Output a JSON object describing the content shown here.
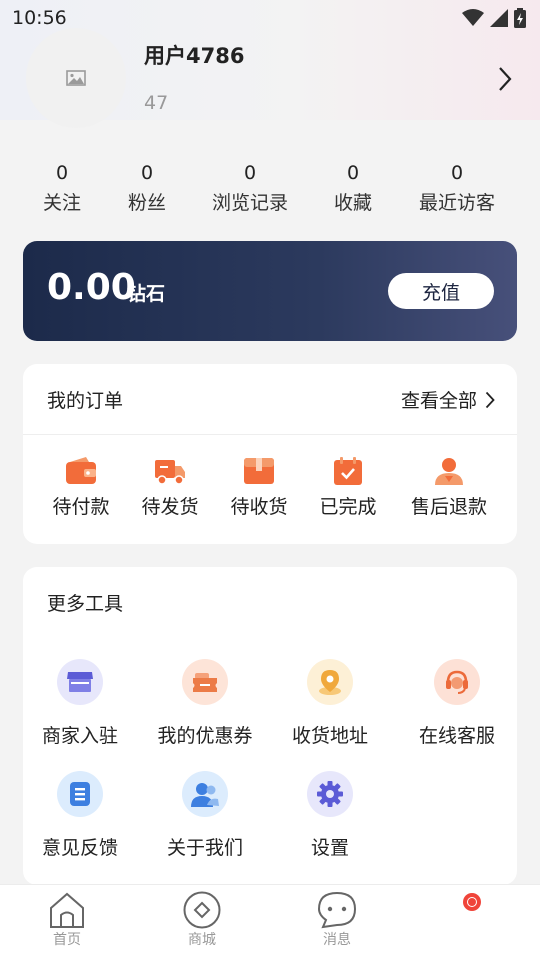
{
  "status_bar": {
    "time": "10:56"
  },
  "profile": {
    "username": "用户4786",
    "sub_value": "47"
  },
  "stats": [
    {
      "value": "0",
      "label": "关注"
    },
    {
      "value": "0",
      "label": "粉丝"
    },
    {
      "value": "0",
      "label": "浏览记录"
    },
    {
      "value": "0",
      "label": "收藏"
    },
    {
      "value": "0",
      "label": "最近访客"
    }
  ],
  "balance": {
    "value": "0.00",
    "unit": "钻石",
    "recharge_label": "充值"
  },
  "orders": {
    "title": "我的订单",
    "view_all": "查看全部",
    "items": [
      {
        "label": "待付款",
        "icon": "wallet-icon"
      },
      {
        "label": "待发货",
        "icon": "truck-icon"
      },
      {
        "label": "待收货",
        "icon": "package-icon"
      },
      {
        "label": "已完成",
        "icon": "completed-icon"
      },
      {
        "label": "售后退款",
        "icon": "service-icon"
      }
    ]
  },
  "tools": {
    "title": "更多工具",
    "items": [
      {
        "label": "商家入驻",
        "icon": "store-icon"
      },
      {
        "label": "我的优惠券",
        "icon": "coupon-icon"
      },
      {
        "label": "收货地址",
        "icon": "location-icon"
      },
      {
        "label": "在线客服",
        "icon": "headset-icon"
      },
      {
        "label": "意见反馈",
        "icon": "feedback-icon"
      },
      {
        "label": "关于我们",
        "icon": "users-icon"
      },
      {
        "label": "设置",
        "icon": "gear-icon"
      }
    ]
  },
  "tabbar": {
    "items": [
      {
        "label": "首页",
        "icon": "home-icon"
      },
      {
        "label": "商城",
        "icon": "shop-icon"
      },
      {
        "label": "消息",
        "icon": "message-icon"
      },
      {
        "label": "",
        "icon": "profile-icon"
      }
    ]
  },
  "colors": {
    "accent": "#f26c3a",
    "card_dark": "#1c2a4a",
    "tool_purple": "#5b5bd6",
    "tool_orange": "#ec7b47",
    "tool_blue": "#3d7fe0"
  }
}
